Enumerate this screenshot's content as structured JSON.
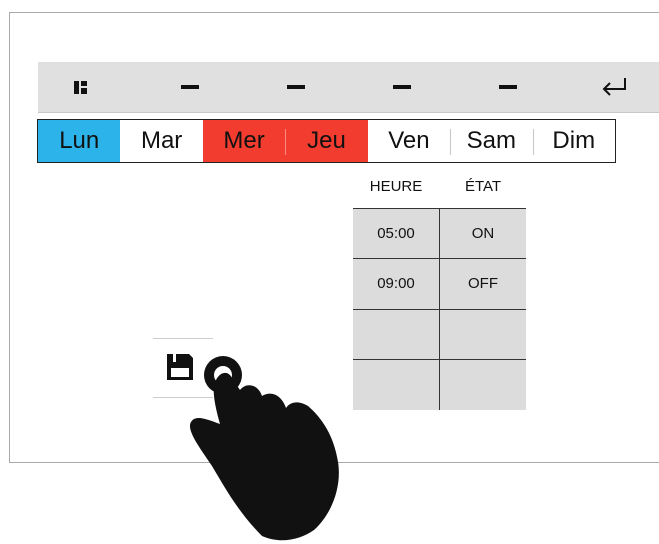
{
  "toolbar": {
    "buttons": [
      {
        "icon": "grid-icon"
      },
      {
        "icon": "dash-icon"
      },
      {
        "icon": "dash-icon"
      },
      {
        "icon": "dash-icon"
      },
      {
        "icon": "dash-icon"
      },
      {
        "icon": "return-icon"
      }
    ]
  },
  "days": [
    {
      "label": "Lun",
      "state": "active"
    },
    {
      "label": "Mar",
      "state": "normal"
    },
    {
      "label": "Mer",
      "state": "selected"
    },
    {
      "label": "Jeu",
      "state": "selected"
    },
    {
      "label": "Ven",
      "state": "normal"
    },
    {
      "label": "Sam",
      "state": "normal"
    },
    {
      "label": "Dim",
      "state": "normal"
    }
  ],
  "schedule": {
    "headers": {
      "time": "HEURE",
      "state": "ÉTAT"
    },
    "rows": [
      {
        "time": "05:00",
        "state": "ON"
      },
      {
        "time": "09:00",
        "state": "OFF"
      },
      {
        "time": "",
        "state": ""
      },
      {
        "time": "",
        "state": ""
      }
    ]
  },
  "save": {
    "icon": "floppy-disk-icon"
  },
  "colors": {
    "active_day": "#2cb4ea",
    "selected_day": "#f13c2f",
    "table_bg": "#dcdcdc",
    "toolbar_bg": "#e0e0e0"
  }
}
